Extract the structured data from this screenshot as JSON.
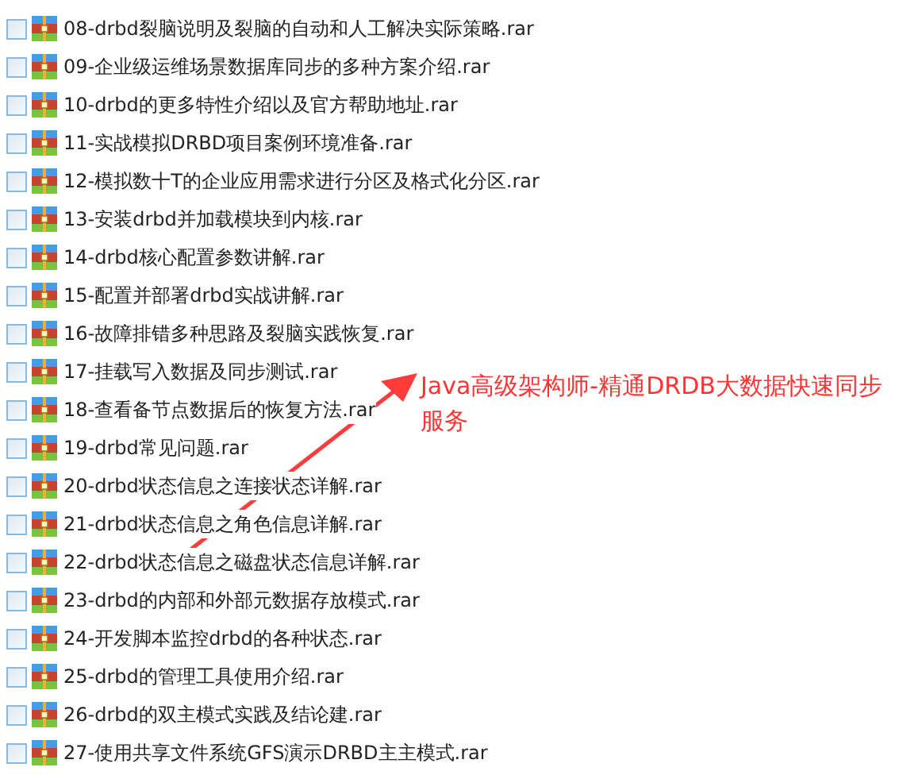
{
  "files": [
    {
      "name": "08-drbd裂脑说明及裂脑的自动和人工解决实际策略.rar",
      "checked": false
    },
    {
      "name": "09-企业级运维场景数据库同步的多种方案介绍.rar",
      "checked": false
    },
    {
      "name": "10-drbd的更多特性介绍以及官方帮助地址.rar",
      "checked": false
    },
    {
      "name": "11-实战模拟DRBD项目案例环境准备.rar",
      "checked": false
    },
    {
      "name": "12-模拟数十T的企业应用需求进行分区及格式化分区.rar",
      "checked": false
    },
    {
      "name": "13-安装drbd并加载模块到内核.rar",
      "checked": false
    },
    {
      "name": "14-drbd核心配置参数讲解.rar",
      "checked": false
    },
    {
      "name": "15-配置并部署drbd实战讲解.rar",
      "checked": false
    },
    {
      "name": "16-故障排错多种思路及裂脑实践恢复.rar",
      "checked": false
    },
    {
      "name": "17-挂载写入数据及同步测试.rar",
      "checked": false
    },
    {
      "name": "18-查看备节点数据后的恢复方法.rar",
      "checked": false
    },
    {
      "name": "19-drbd常见问题.rar",
      "checked": false
    },
    {
      "name": "20-drbd状态信息之连接状态详解.rar",
      "checked": false
    },
    {
      "name": "21-drbd状态信息之角色信息详解.rar",
      "checked": false
    },
    {
      "name": "22-drbd状态信息之磁盘状态信息详解.rar",
      "checked": false
    },
    {
      "name": "23-drbd的内部和外部元数据存放模式.rar",
      "checked": false
    },
    {
      "name": "24-开发脚本监控drbd的各种状态.rar",
      "checked": false
    },
    {
      "name": "25-drbd的管理工具使用介绍.rar",
      "checked": false
    },
    {
      "name": "26-drbd的双主模式实践及结论建.rar",
      "checked": false
    },
    {
      "name": "27-使用共享文件系统GFS演示DRBD主主模式.rar",
      "checked": false
    }
  ],
  "annotation": {
    "text": "Java高级架构师-精通DRDB大数据快速同步服务"
  }
}
